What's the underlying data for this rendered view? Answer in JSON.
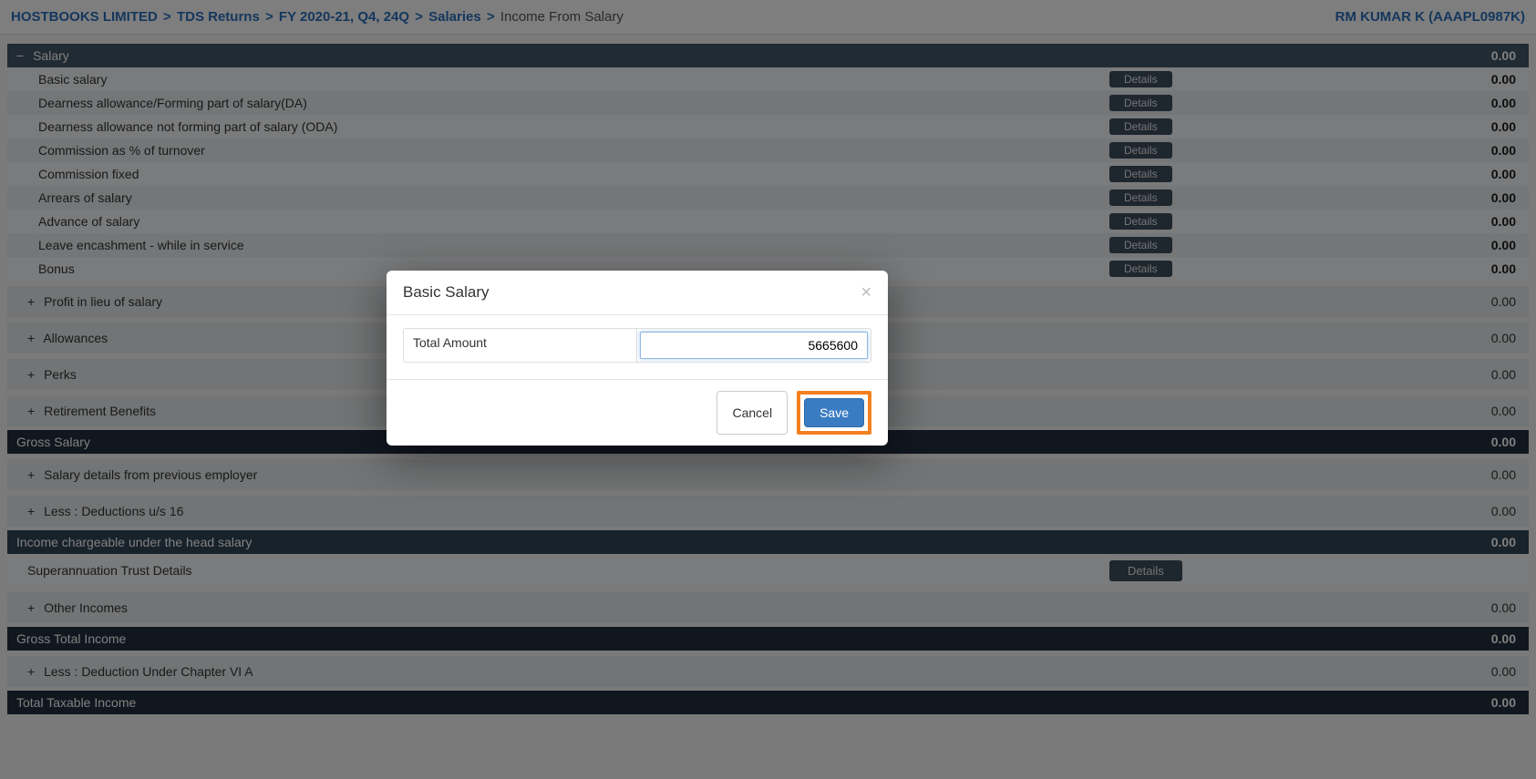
{
  "breadcrumb": {
    "items": [
      "HOSTBOOKS LIMITED",
      "TDS Returns",
      "FY 2020-21, Q4, 24Q",
      "Salaries"
    ],
    "current": "Income From Salary"
  },
  "user_tag": "RM KUMAR K (AAAPL0987K)",
  "labels": {
    "details": "Details"
  },
  "salary_section": {
    "title": "Salary",
    "amount": "0.00",
    "items": [
      {
        "label": "Basic salary",
        "amount": "0.00"
      },
      {
        "label": "Dearness allowance/Forming part of salary(DA)",
        "amount": "0.00"
      },
      {
        "label": "Dearness allowance not forming part of salary (ODA)",
        "amount": "0.00"
      },
      {
        "label": "Commission as % of turnover",
        "amount": "0.00"
      },
      {
        "label": "Commission fixed",
        "amount": "0.00"
      },
      {
        "label": "Arrears of salary",
        "amount": "0.00"
      },
      {
        "label": "Advance of salary",
        "amount": "0.00"
      },
      {
        "label": "Leave encashment - while in service",
        "amount": "0.00"
      },
      {
        "label": "Bonus",
        "amount": "0.00"
      }
    ]
  },
  "collapsibles": [
    {
      "label": "Profit in lieu of salary",
      "amount": "0.00"
    },
    {
      "label": "Allowances",
      "amount": "0.00"
    },
    {
      "label": "Perks",
      "amount": "0.00"
    },
    {
      "label": "Retirement Benefits",
      "amount": "0.00"
    }
  ],
  "summary1": {
    "label": "Gross Salary",
    "amount": "0.00"
  },
  "collapsibles2": [
    {
      "label": "Salary details from previous employer",
      "amount": "0.00"
    },
    {
      "label": "Less : Deductions u/s 16",
      "amount": "0.00"
    }
  ],
  "summary2": {
    "label": "Income chargeable under the head salary",
    "amount": "0.00"
  },
  "superannuation": {
    "label": "Superannuation Trust Details"
  },
  "collapsibles3": [
    {
      "label": "Other Incomes",
      "amount": "0.00"
    }
  ],
  "summary3": {
    "label": "Gross Total Income",
    "amount": "0.00"
  },
  "collapsibles4": [
    {
      "label": "Less : Deduction Under Chapter VI A",
      "amount": "0.00"
    }
  ],
  "summary4": {
    "label": "Total Taxable Income",
    "amount": "0.00"
  },
  "modal": {
    "title": "Basic Salary",
    "field_label": "Total Amount",
    "field_value": "5665600",
    "cancel": "Cancel",
    "save": "Save"
  }
}
